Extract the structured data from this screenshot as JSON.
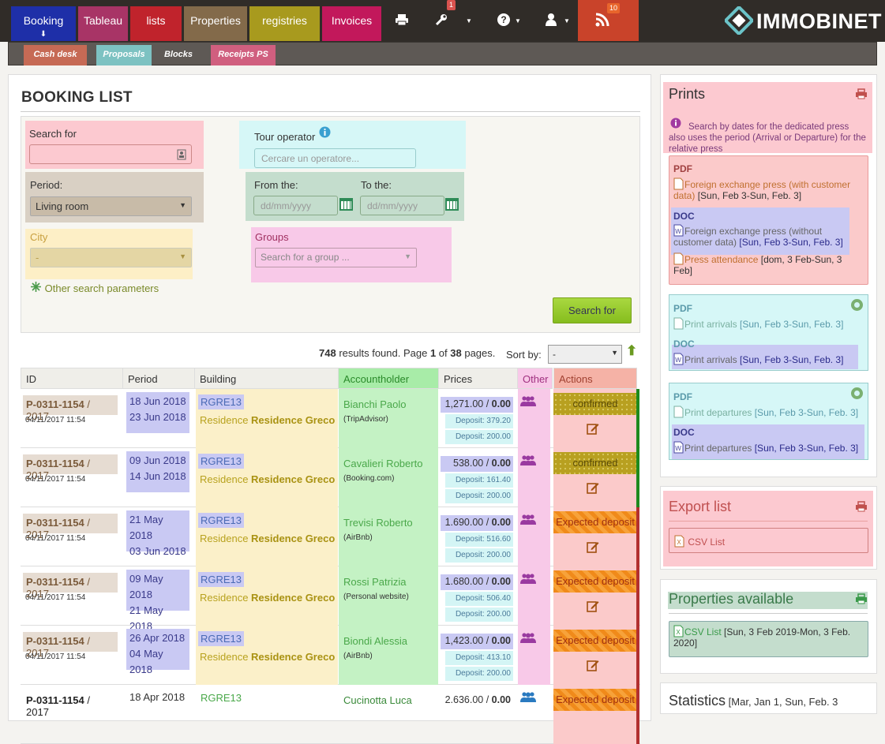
{
  "nav": {
    "tabs": [
      {
        "label": "Booking",
        "color": "#1e2fa8"
      },
      {
        "label": "Tableau",
        "color": "#a83466"
      },
      {
        "label": "lists",
        "color": "#c0232c"
      },
      {
        "label": "Properties",
        "color": "#836a4a"
      },
      {
        "label": "registries",
        "color": "#a89a1e"
      },
      {
        "label": "Invoices",
        "color": "#c2185b"
      }
    ],
    "booking_sub": "⬇",
    "tools_badge": "1",
    "rss_badge": "10",
    "logo_text": "IMMOBINET",
    "icons": [
      "print-icon",
      "wrench-icon",
      "help-icon",
      "user-icon",
      "rss-icon"
    ]
  },
  "subnav": {
    "tabs": [
      {
        "label": "Cash desk",
        "color": "#c66a55"
      },
      {
        "label": "Proposals",
        "color": "#7dc2c2"
      },
      {
        "label": "Blocks",
        "color": ""
      },
      {
        "label": "Receipts PS",
        "color": "#d05f7f"
      }
    ]
  },
  "main": {
    "title": "BOOKING LIST",
    "search": {
      "search_for_label": "Search for",
      "tour_operator_label": "Tour operator",
      "tour_operator_placeholder": "Cercare un operatore...",
      "period_label": "Period:",
      "period_value": "Living room",
      "from_label": "From the:",
      "to_label": "To the:",
      "date_placeholder": "dd/mm/yyyy",
      "city_label": "City",
      "city_value": "-",
      "groups_label": "Groups",
      "groups_placeholder": "Search for a group ...",
      "other_params": "Other search parameters",
      "search_button": "Search for"
    },
    "results": {
      "count": "748",
      "text1": " results found. Page ",
      "page": "1",
      "text2": " of ",
      "pages": "38",
      "text3": " pages."
    },
    "sort_label": "Sort by:",
    "sort_value": "-",
    "table": {
      "headers": [
        "ID",
        "Period",
        "Building",
        "Accountholder",
        "Prices",
        "Other",
        "Actions"
      ],
      "rows": [
        {
          "id": "P-0311-1154",
          "year": " / 2017",
          "created": "04/11/2017 11:54",
          "from": "18 Jun 2018",
          "to": "23 Jun 2018",
          "bcode": "RGRE13",
          "bprefix": "Residence ",
          "bname": "Residence Greco",
          "holder": "Bianchi Paolo",
          "source": "(TripAdvisor)",
          "price": "1,271.00 / ",
          "paid": "0.00",
          "dep1": "Deposit: 379.20",
          "dep2": "Deposit: 200.00",
          "status": "confirmed",
          "stype": "confirmed"
        },
        {
          "id": "P-0311-1154",
          "year": " / 2017",
          "created": "04/11/2017 11:54",
          "from": "09 Jun 2018",
          "to": "14 Jun 2018",
          "bcode": "RGRE13",
          "bprefix": "Residence ",
          "bname": "Residence Greco",
          "holder": "Cavalieri Roberto",
          "source": "(Booking.com)",
          "price": "538.00 / ",
          "paid": "0.00",
          "dep1": "Deposit: 161.40",
          "dep2": "Deposit: 200.00",
          "status": "confirmed",
          "stype": "confirmed"
        },
        {
          "id": "P-0311-1154",
          "year": " / 2017",
          "created": "04/11/2017 11:54",
          "from": "21 May 2018",
          "to": "03 Jun 2018",
          "bcode": "RGRE13",
          "bprefix": "Residence ",
          "bname": "Residence Greco",
          "holder": "Trevisi Roberto",
          "source": "(AirBnb)",
          "price": "1.690.00 / ",
          "paid": "0.00",
          "dep1": "Deposit: 516.60",
          "dep2": "Deposit: 200.00",
          "status": "Expected deposit",
          "stype": "expected"
        },
        {
          "id": "P-0311-1154",
          "year": " / 2017",
          "created": "04/11/2017 11:54",
          "from": "09 May 2018",
          "to": "21 May 2018",
          "bcode": "RGRE13",
          "bprefix": "Residence ",
          "bname": "Residence Greco",
          "holder": "Rossi Patrizia",
          "source": "(Personal website)",
          "price": "1.680.00 / ",
          "paid": "0.00",
          "dep1": "Deposit: 506.40",
          "dep2": "Deposit: 200.00",
          "status": "Expected deposit",
          "stype": "expected"
        },
        {
          "id": "P-0311-1154",
          "year": " / 2017",
          "created": "04/11/2017 11:54",
          "from": "26 Apr 2018",
          "to": "04 May 2018",
          "bcode": "RGRE13",
          "bprefix": "Residence ",
          "bname": "Residence Greco",
          "holder": "Biondi Alessia",
          "source": "(AirBnb)",
          "price": "1,423.00 / ",
          "paid": "0.00",
          "dep1": "Deposit: 413.10",
          "dep2": "Deposit: 200.00",
          "status": "Expected deposit",
          "stype": "expected"
        },
        {
          "id": "P-0311-1154",
          "year": " / 2017",
          "created": "",
          "from": "18 Apr 2018",
          "to": "",
          "bcode": "RGRE13",
          "bprefix": "",
          "bname": "",
          "holder": "Cucinotta Luca",
          "source": "",
          "price": "2.636.00 / ",
          "paid": "0.00",
          "dep1": "",
          "dep2": "",
          "status": "Expected deposit",
          "stype": "expected"
        }
      ]
    }
  },
  "sidebar": {
    "prints": {
      "title": "Prints",
      "info": "Search by dates for the dedicated press also uses the period (Arrival or Departure) for the relative press",
      "pdf_tag": "PDF",
      "doc_tag": "DOC",
      "item1": "Foreign exchange press (with customer data)",
      "item1_date": " [Sun, Feb 3-Sun, Feb. 3]",
      "item2": "Foreign exchange press (without customer data)",
      "item2_date": " [Sun, Feb 3-Sun, Feb. 3]",
      "item3": "Press attendance",
      "item3_date": " [dom, 3 Feb-Sun, 3 Feb]",
      "arrivals": "Print arrivals",
      "arrivals_date": " [Sun, Feb 3-Sun, Feb. 3]",
      "departures": "Print departures",
      "departures_date": " [Sun, Feb 3-Sun, Feb. 3]"
    },
    "export": {
      "title": "Export list",
      "csv": "CSV List"
    },
    "properties": {
      "title": "Properties available",
      "csv": "CSV List",
      "date": " [Sun, 3 Feb 2019-Mon, 3 Feb. 2020]"
    },
    "statistics": {
      "title": "Statistics",
      "date": "[Mar, Jan 1, Sun, Feb. 3"
    }
  }
}
